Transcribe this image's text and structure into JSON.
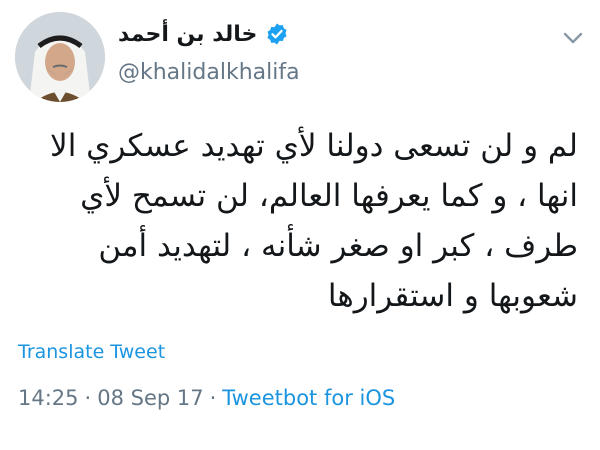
{
  "tweet": {
    "author": {
      "display_name": "خالد بن أحمد",
      "handle": "@khalidalkhalifa",
      "verified": true,
      "verified_icon": "verified-badge-icon"
    },
    "menu_icon": "chevron-down-icon",
    "text": "لم و لن تسعى دولنا لأي تهديد عسكري الا انها ، و كما يعرفها العالم، لن تسمح لأي طرف ، كبر او صغر شأنه ، لتهديد أمن شعوبها و استقرارها",
    "translate_label": "Translate Tweet",
    "time": "14:25",
    "date": "08 Sep 17",
    "separator": "·",
    "source": "Tweetbot for iOS"
  },
  "colors": {
    "link": "#1b95e0",
    "muted": "#657786",
    "text": "#14171a",
    "verified": "#1da1f2"
  }
}
